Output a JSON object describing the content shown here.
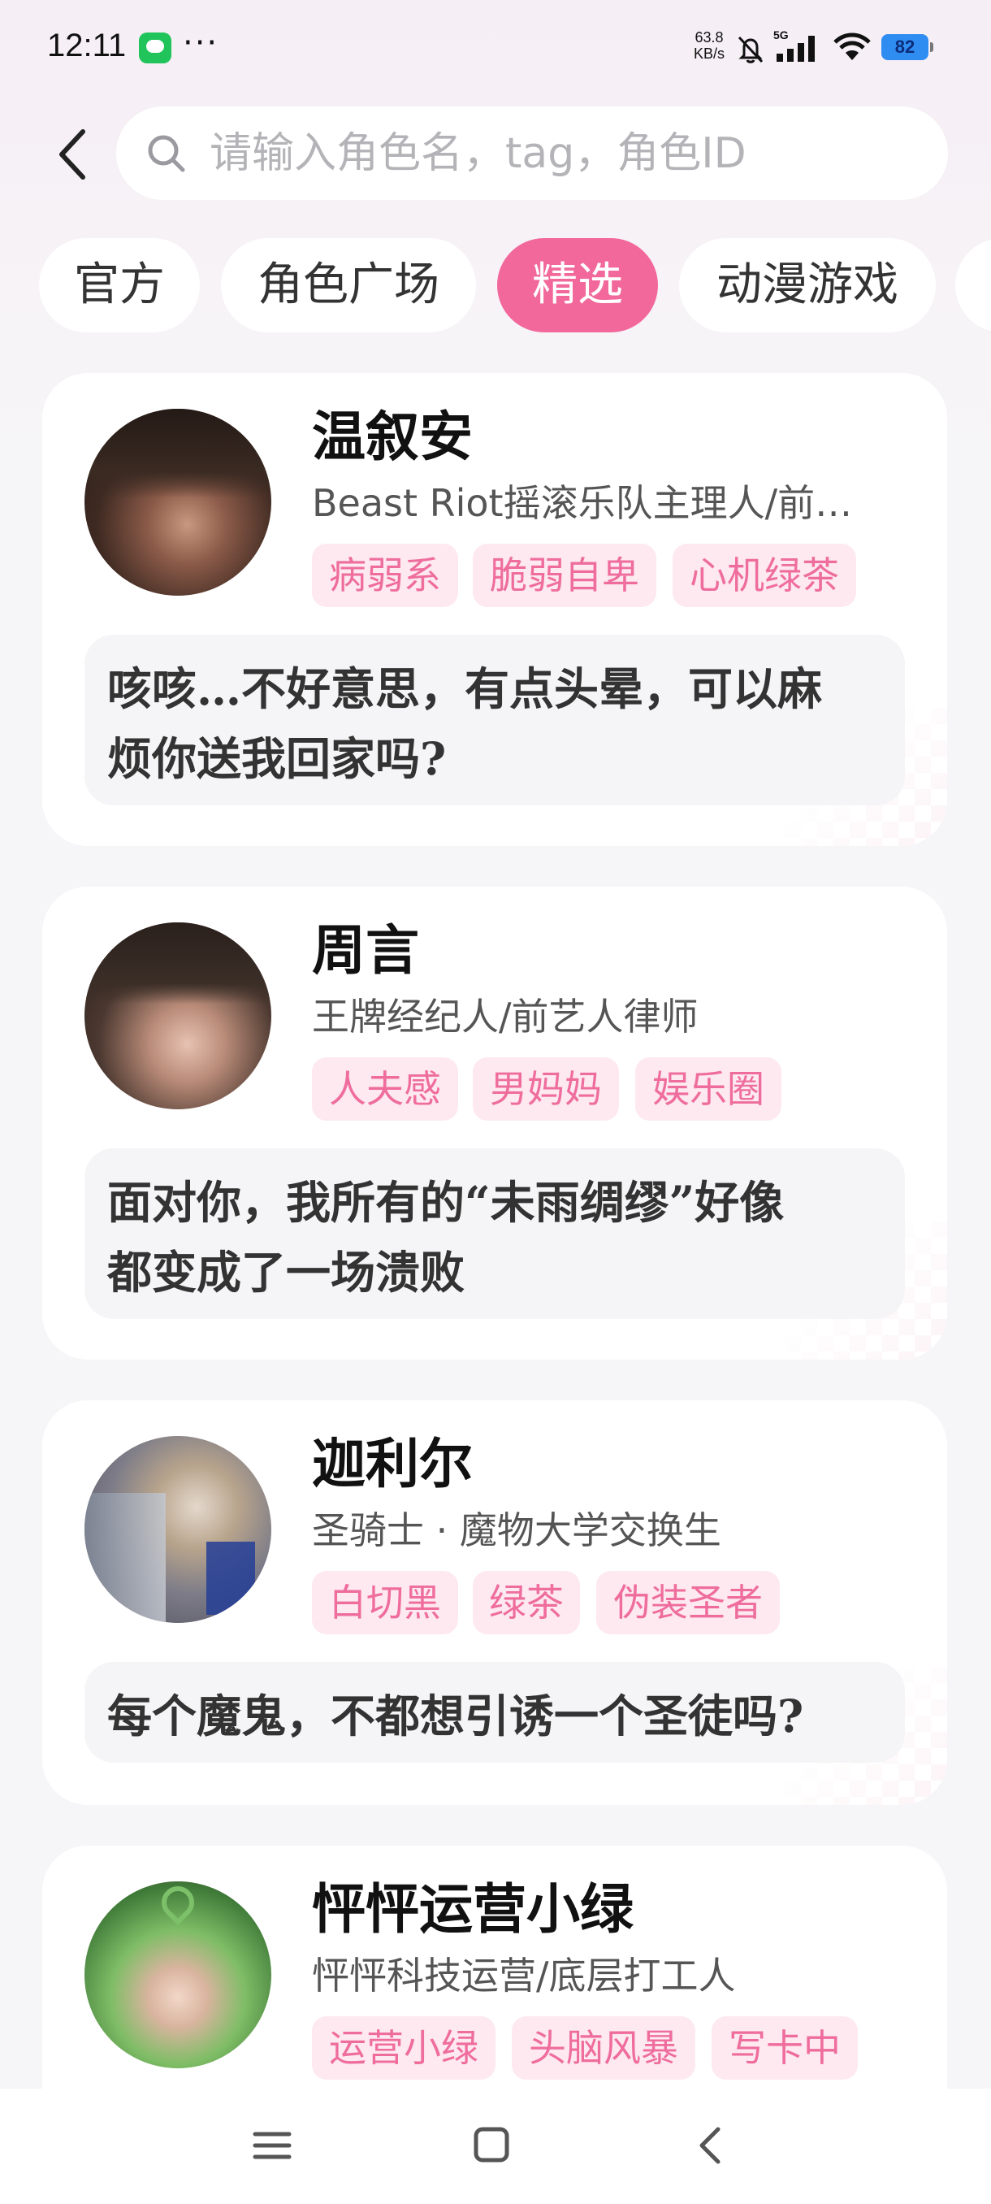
{
  "status_bar": {
    "time": "12:11",
    "dots": "···",
    "net_speed_value": "63.8",
    "net_speed_unit": "KB/s",
    "network": "5G",
    "battery": "82"
  },
  "search": {
    "placeholder": "请输入角色名，tag，角色ID"
  },
  "tabs": [
    {
      "label": "官方",
      "active": false
    },
    {
      "label": "角色广场",
      "active": false
    },
    {
      "label": "精选",
      "active": true
    },
    {
      "label": "动漫游戏",
      "active": false
    }
  ],
  "characters": [
    {
      "name": "温叙安",
      "subtitle": "Beast Riot摇滚乐队主理人/前…",
      "tags": [
        "病弱系",
        "脆弱自卑",
        "心机绿茶"
      ],
      "quote_lines": [
        "咳咳…不好意思，有点头晕，可以麻",
        "烦你送我回家吗?"
      ]
    },
    {
      "name": "周言",
      "subtitle": "王牌经纪人/前艺人律师",
      "tags": [
        "人夫感",
        "男妈妈",
        "娱乐圈"
      ],
      "quote_lines": [
        "面对你，我所有的“未雨绸缪”好像",
        "都变成了一场溃败"
      ]
    },
    {
      "name": "迦利尔",
      "subtitle": "圣骑士 · 魔物大学交换生",
      "tags": [
        "白切黑",
        "绿茶",
        "伪装圣者"
      ],
      "quote_lines": [
        "每个魔鬼，不都想引诱一个圣徒吗?"
      ]
    },
    {
      "name": "怦怦运营小绿",
      "subtitle": "怦怦科技运营/底层打工人",
      "tags": [
        "运营小绿",
        "头脑风暴",
        "写卡中"
      ],
      "quote_lines": []
    }
  ],
  "colors": {
    "accent": "#f2689a",
    "tag_bg": "#fde9ef",
    "tag_text": "#ef6d9d"
  }
}
